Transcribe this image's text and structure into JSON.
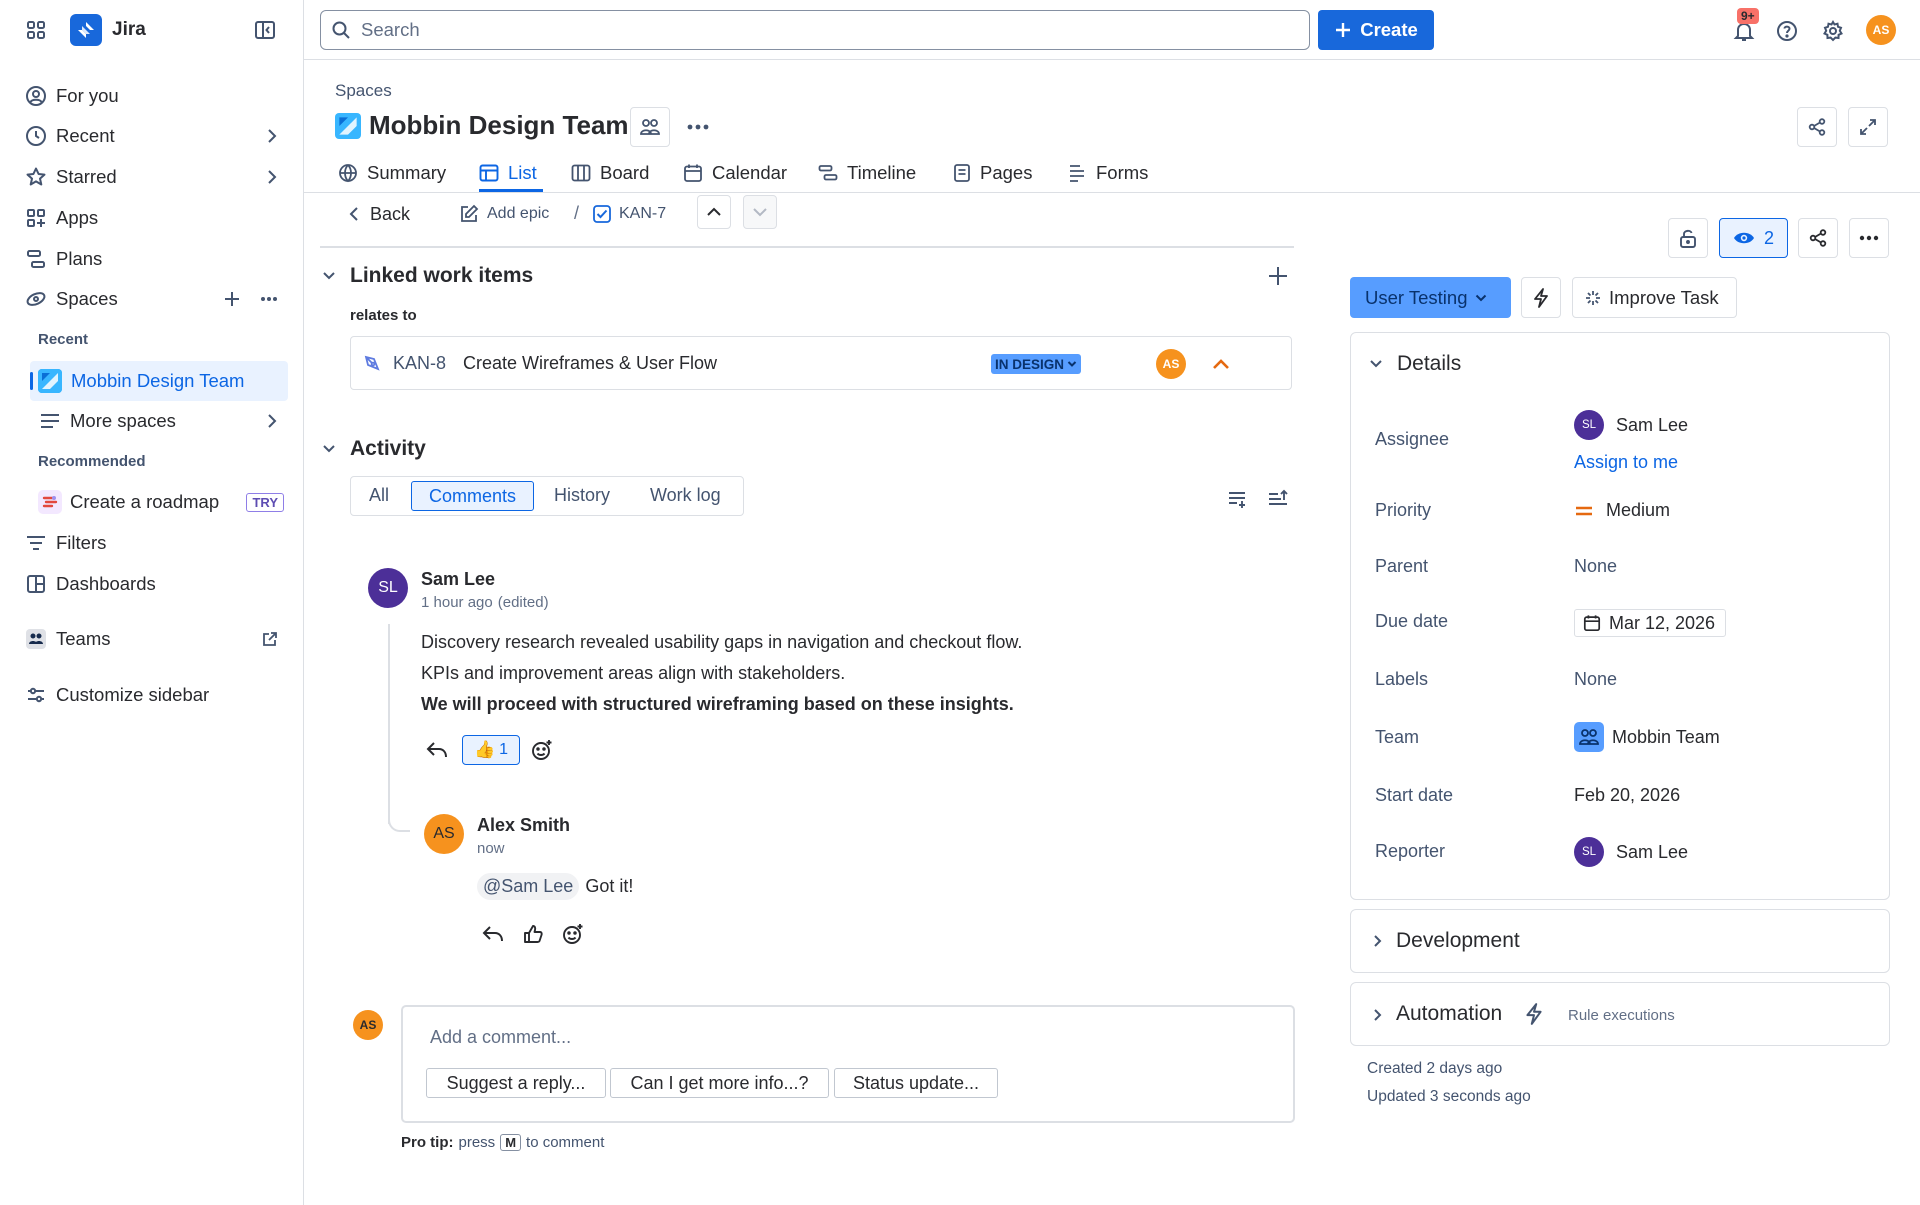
{
  "app": {
    "name": "Jira"
  },
  "search": {
    "placeholder": "Search"
  },
  "header": {
    "create_label": "Create",
    "notif_badge": "9+",
    "user_initials": "AS"
  },
  "sidebar": {
    "for_you": "For you",
    "recent": "Recent",
    "starred": "Starred",
    "apps": "Apps",
    "plans": "Plans",
    "spaces": "Spaces",
    "recent_heading": "Recent",
    "active_space": "Mobbin Design Team",
    "more_spaces": "More spaces",
    "recommended_heading": "Recommended",
    "create_roadmap": "Create a roadmap",
    "try_badge": "TRY",
    "filters": "Filters",
    "dashboards": "Dashboards",
    "teams": "Teams",
    "customize": "Customize sidebar"
  },
  "project": {
    "breadcrumb": "Spaces",
    "title": "Mobbin Design Team",
    "tabs": [
      "Summary",
      "List",
      "Board",
      "Calendar",
      "Timeline",
      "Pages",
      "Forms"
    ],
    "active_tab": "List"
  },
  "issue_nav": {
    "back": "Back",
    "add_epic": "Add epic",
    "separator": "/",
    "issue_key": "KAN-7"
  },
  "linked": {
    "title": "Linked work items",
    "relation": "relates to",
    "item_key": "KAN-8",
    "item_summary": "Create Wireframes & User Flow",
    "item_status": "IN DESIGN",
    "item_assignee": "AS"
  },
  "activity": {
    "title": "Activity",
    "filters": [
      "All",
      "Comments",
      "History",
      "Work log"
    ],
    "active_filter": "Comments",
    "comment1": {
      "initials": "SL",
      "author": "Sam Lee",
      "time": "1 hour ago",
      "edited": "(edited)",
      "line1": "Discovery research revealed usability gaps in navigation and checkout flow.",
      "line2": "KPIs and improvement areas align with stakeholders.",
      "line3": "We will proceed with structured wireframing based on these insights.",
      "reaction_emoji": "👍",
      "reaction_count": "1"
    },
    "comment2": {
      "initials": "AS",
      "author": "Alex Smith",
      "time": "now",
      "mention": "@Sam Lee",
      "text": "Got it!"
    },
    "composer": {
      "initials": "AS",
      "placeholder": "Add a comment...",
      "suggestions": [
        "Suggest a reply...",
        "Can I get more info...?",
        "Status update..."
      ],
      "tip_bold": "Pro tip:",
      "tip_text": "press",
      "tip_key": "M",
      "tip_end": "to comment"
    }
  },
  "right": {
    "watch_count": "2",
    "status_button": "User Testing",
    "improve_task": "Improve Task",
    "details": {
      "title": "Details",
      "assignee_label": "Assignee",
      "assignee_initials": "SL",
      "assignee_name": "Sam Lee",
      "assign_to_me": "Assign to me",
      "priority_label": "Priority",
      "priority_value": "Medium",
      "parent_label": "Parent",
      "parent_value": "None",
      "due_label": "Due date",
      "due_value": "Mar 12, 2026",
      "labels_label": "Labels",
      "labels_value": "None",
      "team_label": "Team",
      "team_value": "Mobbin Team",
      "start_label": "Start date",
      "start_value": "Feb 20, 2026",
      "reporter_label": "Reporter",
      "reporter_initials": "SL",
      "reporter_name": "Sam Lee"
    },
    "development": "Development",
    "automation": "Automation",
    "rule_executions": "Rule executions",
    "created": "Created 2 days ago",
    "updated": "Updated 3 seconds ago"
  },
  "colors": {
    "accent": "#0c66e4",
    "active_bg": "#e9f2ff",
    "status_blue": "#579dff",
    "avatar_orange": "#f6921e",
    "avatar_purple": "#4c2f98",
    "priority_medium": "#e56910"
  }
}
